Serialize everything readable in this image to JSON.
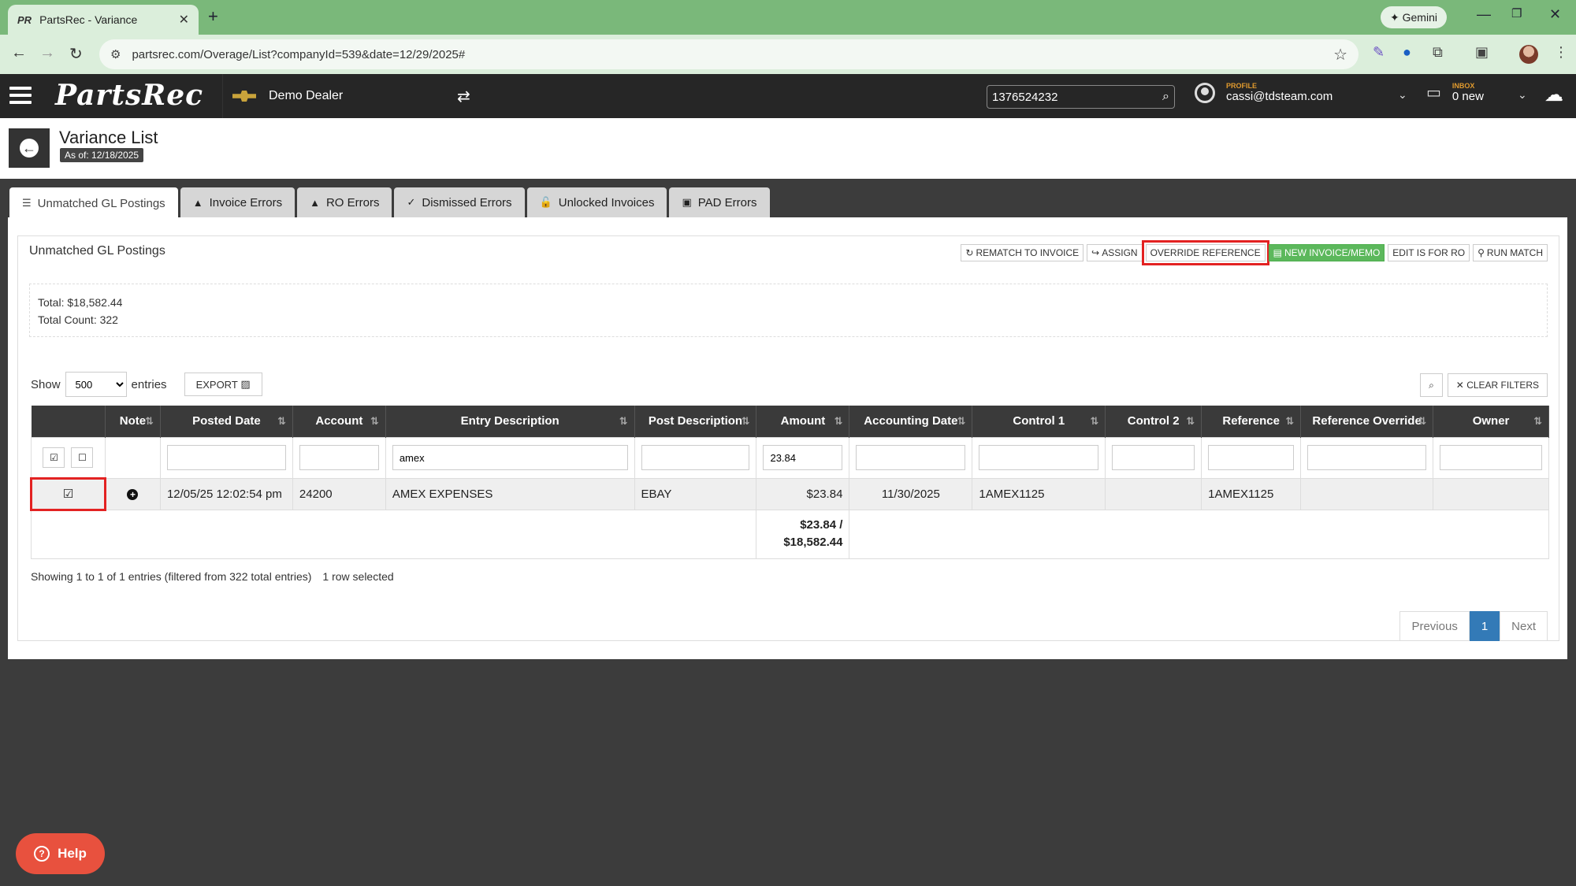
{
  "browser": {
    "tab_title": "PartsRec - Variance",
    "tab_favicon": "PR",
    "url": "partsrec.com/Overage/List?companyId=539&date=12/29/2025#",
    "gemini_label": "Gemini"
  },
  "app": {
    "logo": "PartsRec",
    "dealer": "Demo Dealer",
    "search_value": "1376524232",
    "profile_label": "PROFILE",
    "profile_email": "cassi@tdsteam.com",
    "inbox_label": "INBOX",
    "inbox_count": "0 new"
  },
  "page": {
    "title": "Variance List",
    "as_of": "As of: 12/18/2025"
  },
  "tabs": [
    {
      "label": "Unmatched GL Postings",
      "icon": "list-icon",
      "active": true
    },
    {
      "label": "Invoice Errors",
      "icon": "warning-icon"
    },
    {
      "label": "RO Errors",
      "icon": "warning-icon"
    },
    {
      "label": "Dismissed Errors",
      "icon": "check-circle-icon"
    },
    {
      "label": "Unlocked Invoices",
      "icon": "unlock-icon"
    },
    {
      "label": "PAD Errors",
      "icon": "square-icon"
    }
  ],
  "panel": {
    "title": "Unmatched GL Postings",
    "actions": {
      "rematch": "REMATCH TO INVOICE",
      "assign": "ASSIGN",
      "override": "OVERRIDE REFERENCE",
      "new_invoice": "NEW INVOICE/MEMO",
      "edit_ro": "EDIT IS FOR RO",
      "run_match": "RUN MATCH"
    },
    "total": "Total: $18,582.44",
    "total_count": "Total Count: 322"
  },
  "controls": {
    "show_label": "Show",
    "show_value": "500",
    "entries_label": "entries",
    "export_label": "EXPORT",
    "clear_filters": "CLEAR FILTERS"
  },
  "table": {
    "columns": [
      "",
      "Note",
      "Posted Date",
      "Account",
      "Entry Description",
      "Post Description",
      "Amount",
      "Accounting Date",
      "Control 1",
      "Control 2",
      "Reference",
      "Reference Override",
      "Owner"
    ],
    "filters": {
      "entry_description": "amex",
      "amount": "23.84"
    },
    "rows": [
      {
        "posted_date": "12/05/25 12:02:54 pm",
        "account": "24200",
        "entry_description": "AMEX EXPENSES",
        "post_description": "EBAY",
        "amount": "$23.84",
        "accounting_date": "11/30/2025",
        "control1": "1AMEX1125",
        "control2": "",
        "reference": "1AMEX1125",
        "reference_override": "",
        "owner": ""
      }
    ],
    "sum_line1": "$23.84 /",
    "sum_line2": "$18,582.44"
  },
  "footer": {
    "showing": "Showing 1 to 1 of 1 entries (filtered from 322 total entries)",
    "selected": "1 row selected",
    "prev": "Previous",
    "page": "1",
    "next": "Next"
  },
  "help_label": "Help"
}
